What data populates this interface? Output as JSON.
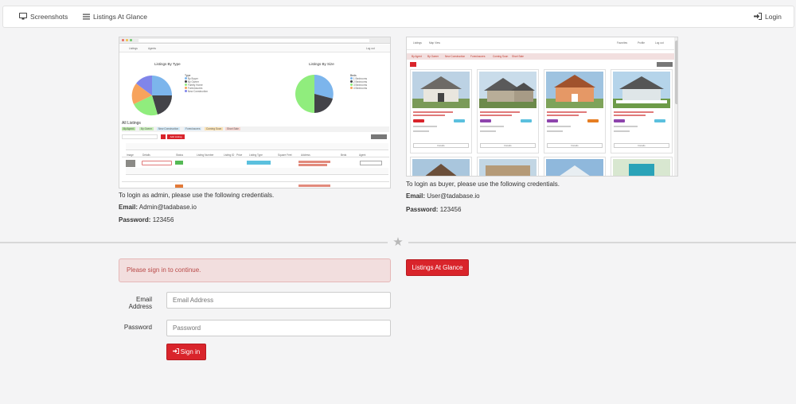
{
  "nav": {
    "screenshots_label": "Screenshots",
    "listings_label": "Listings At Glance",
    "login_label": "Login"
  },
  "admin_ss": {
    "nav_listings": "Listings",
    "nav_agents": "Agents",
    "nav_logout": "Log out",
    "chart1_title": "Listings By Type",
    "chart2_title": "Listings By Size",
    "legend1": [
      "By Buyer",
      "By Owner",
      "Family Home",
      "Foreclosures",
      "New Construction"
    ],
    "legend2": [
      "1 Bedrooms",
      "2 Bedrooms",
      "3 Bedrooms",
      "4 Bedrooms"
    ],
    "all_listings": "All Listings",
    "tabs": [
      "By Agent",
      "By Owner",
      "New Construction",
      "Foreclosures",
      "Coming Soon",
      "Short Sale"
    ],
    "add_button": "Add Listing",
    "table_headers": [
      "Image",
      "Details",
      "Status",
      "Listing Number",
      "Listing ID",
      "Price",
      "Listing Type",
      "Square Feet",
      "Address",
      "Beds",
      "Agent"
    ]
  },
  "buyer_ss": {
    "nav_listings": "Listings",
    "nav_map": "Map View",
    "nav_favorites": "Favorites",
    "nav_profile": "Profile",
    "nav_logout": "Log out",
    "tabs": [
      "By Agent",
      "By Owner",
      "New Construction",
      "Foreclosures",
      "Coming Soon",
      "Short Sale"
    ],
    "details_label": "Details"
  },
  "admin_cred": {
    "intro": "To login as admin, please use the following credentials.",
    "email_label": "Email:",
    "email_value": "Admin@tadabase.io",
    "password_label": "Password:",
    "password_value": "123456"
  },
  "buyer_cred": {
    "intro": "To login as buyer, please use the following credentials.",
    "email_label": "Email:",
    "email_value": "User@tadabase.io",
    "password_label": "Password:",
    "password_value": "123456"
  },
  "listings_button": "Listings At Glance",
  "login_form": {
    "alert": "Please sign in to continue.",
    "email_label": "Email Address",
    "email_placeholder": "Email Address",
    "password_label": "Password",
    "password_placeholder": "Password",
    "submit_label": "Sign in"
  },
  "colors": {
    "accent_red": "#d9242b",
    "alert_bg": "#f2dede",
    "alert_text": "#b94a48"
  }
}
